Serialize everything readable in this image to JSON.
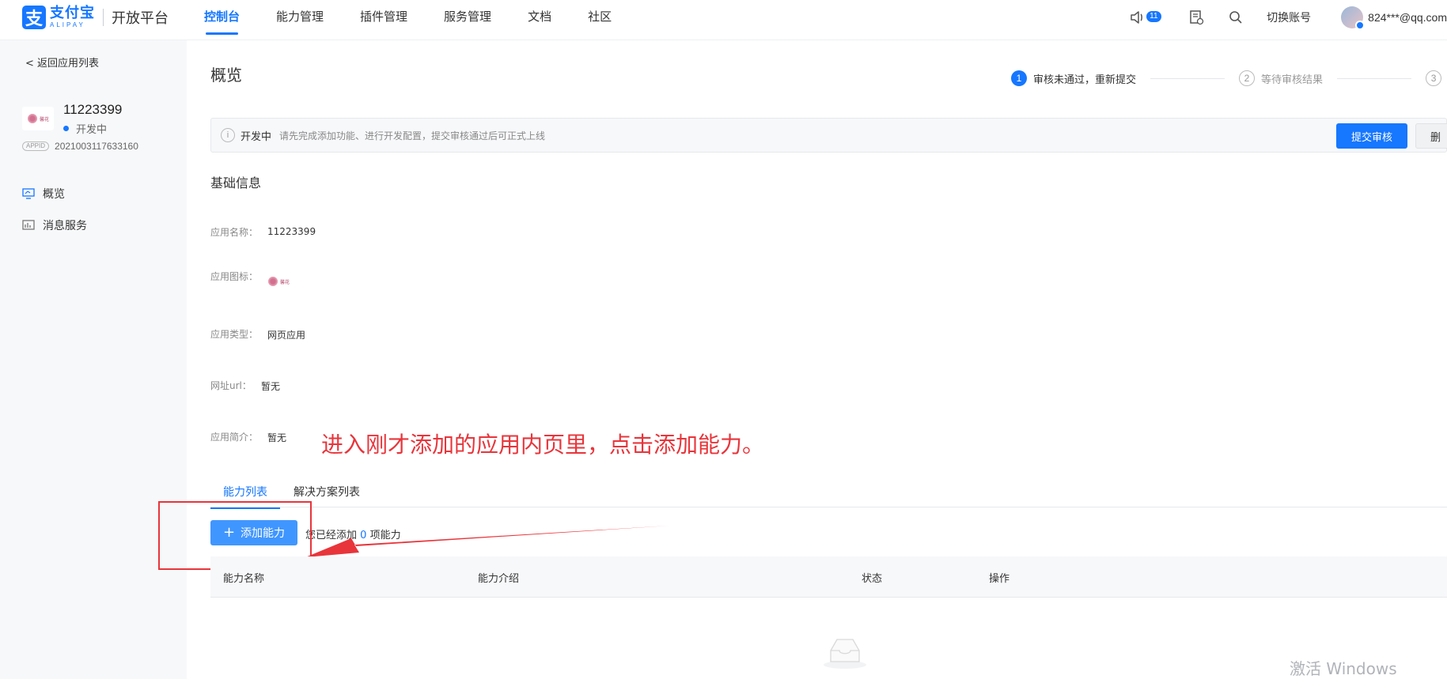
{
  "header": {
    "logo_cn": "支付宝",
    "logo_en": "ALIPAY",
    "logo_sub": "开放平台",
    "nav": [
      {
        "label": "控制台",
        "active": true
      },
      {
        "label": "能力管理"
      },
      {
        "label": "插件管理"
      },
      {
        "label": "服务管理"
      },
      {
        "label": "文档"
      },
      {
        "label": "社区"
      }
    ],
    "notification_count": "11",
    "switch_account": "切换账号",
    "email": "824***@qq.com"
  },
  "sidebar": {
    "back_label": "返回应用列表",
    "app_name": "11223399",
    "app_status": "开发中",
    "appid_tag": "APPID",
    "appid_value": "2021003117633160",
    "thumb_text": "馨花",
    "menu": [
      {
        "label": "概览",
        "icon": "monitor-icon"
      },
      {
        "label": "消息服务",
        "icon": "chart-icon"
      }
    ]
  },
  "main": {
    "title": "概览",
    "steps": [
      {
        "num": "1",
        "label": "审核未通过，重新提交"
      },
      {
        "num": "2",
        "label": "等待审核结果"
      },
      {
        "num": "3",
        "label": ""
      }
    ],
    "alert": {
      "title": "开发中",
      "text": "请先完成添加功能、进行开发配置，提交审核通过后可正式上线",
      "submit": "提交审核",
      "delete": "删"
    },
    "basic_info": {
      "title": "基础信息",
      "fields": [
        {
          "label": "应用名称：",
          "value": "11223399"
        },
        {
          "label": "应用图标：",
          "value": ""
        },
        {
          "label": "应用类型：",
          "value": "网页应用"
        },
        {
          "label": "网址url：",
          "value": "暂无"
        },
        {
          "label": "应用简介：",
          "value": "暂无"
        }
      ]
    },
    "annotation": "进入刚才添加的应用内页里，点击添加能力。",
    "tabs": [
      {
        "label": "能力列表"
      },
      {
        "label": "解决方案列表"
      }
    ],
    "add_button": "添加能力",
    "added_prefix": "您已经添加",
    "added_count": "0",
    "added_suffix": "项能力",
    "table_headers": [
      "能力名称",
      "能力介绍",
      "状态",
      "操作"
    ],
    "watermark": "激活 Windows"
  },
  "colors": {
    "primary": "#1677ff",
    "annotation_red": "#e8353b"
  }
}
